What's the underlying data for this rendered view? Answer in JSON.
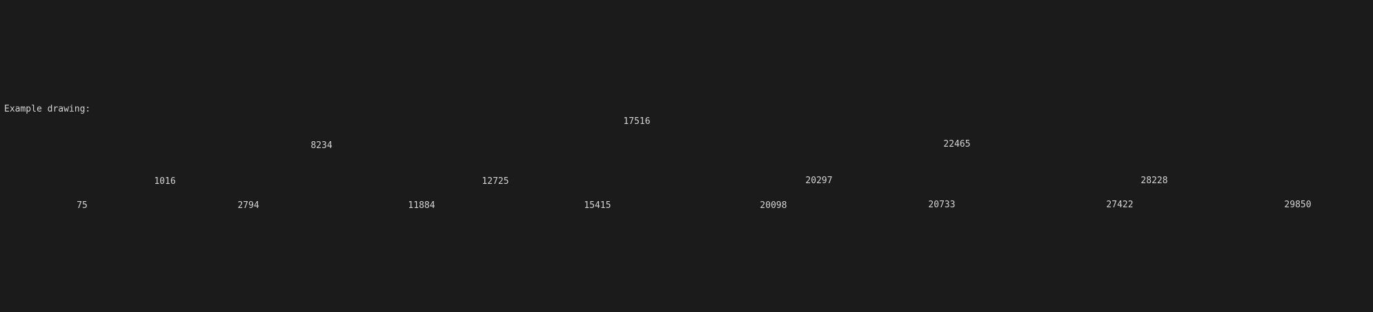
{
  "console": {
    "header": "Example drawing:",
    "tree": {
      "root": "17516",
      "level1": [
        "8234",
        "22465"
      ],
      "level2": [
        "1016",
        "12725",
        "20297",
        "28228"
      ],
      "level3": [
        "75",
        "2794",
        "11884",
        "15415",
        "20098",
        "20733",
        "27422",
        "29850"
      ]
    }
  }
}
